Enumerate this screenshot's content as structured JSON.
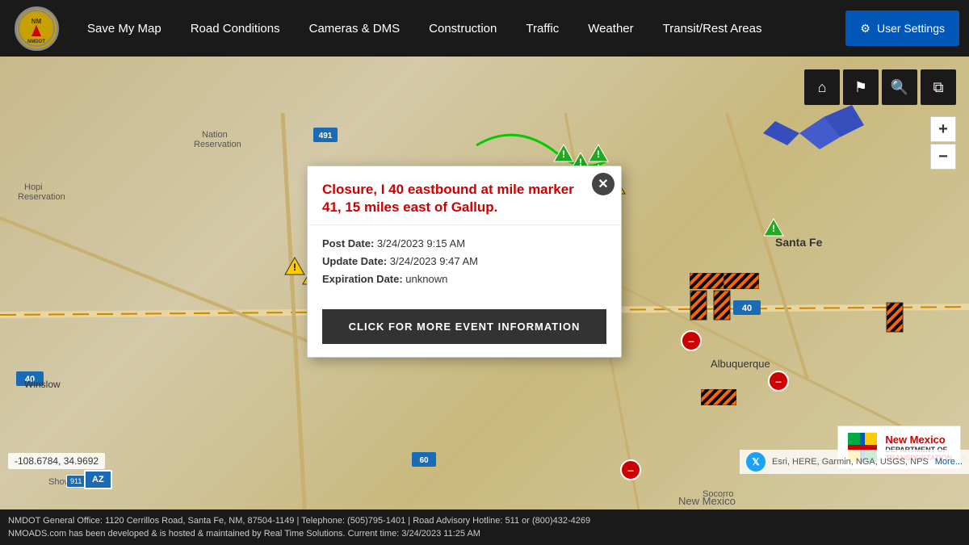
{
  "header": {
    "logo_text": "NMDOT",
    "nav_items": [
      {
        "label": "Save My Map",
        "id": "save-my-map"
      },
      {
        "label": "Road Conditions",
        "id": "road-conditions"
      },
      {
        "label": "Cameras & DMS",
        "id": "cameras-dms"
      },
      {
        "label": "Construction",
        "id": "construction"
      },
      {
        "label": "Traffic",
        "id": "traffic"
      },
      {
        "label": "Weather",
        "id": "weather"
      },
      {
        "label": "Transit/Rest Areas",
        "id": "transit-rest-areas"
      }
    ],
    "user_settings_label": "User Settings"
  },
  "map_toolbar": {
    "home_tooltip": "Home",
    "bookmark_tooltip": "Bookmark",
    "search_tooltip": "Search",
    "layers_tooltip": "Layers"
  },
  "zoom": {
    "in_label": "+",
    "out_label": "−"
  },
  "popup": {
    "title": "Closure, I 40 eastbound at mile marker 41, 15 miles east of Gallup.",
    "post_date_label": "Post Date:",
    "post_date_value": "3/24/2023 9:15 AM",
    "update_date_label": "Update Date:",
    "update_date_value": "3/24/2023 9:47 AM",
    "expiration_label": "Expiration Date:",
    "expiration_value": "unknown",
    "cta_button": "CLICK FOR MORE EVENT INFORMATION"
  },
  "coordinates": {
    "value": "-108.6784, 34.9692"
  },
  "footer": {
    "line1": "NMDOT General Office: 1120 Cerrillos Road, Santa Fe, NM, 87504-1149  |  Telephone: (505)795-1401  |  Road Advisory Hotline: 511 or (800)432-4269",
    "line2": "NMOADS.com has been developed & is hosted & maintained by Real Time Solutions. Current time: 3/24/2023 11:25 AM"
  },
  "attribution": {
    "text": "Esri, HERE, Garmin, NGA, USGS, NPS",
    "more_label": "More..."
  },
  "state_badge": {
    "label": "AZ"
  },
  "nmdot": {
    "name": "New Mexico",
    "dept": "DEPARTMENT OF",
    "division": "TRANSPORTATION"
  }
}
